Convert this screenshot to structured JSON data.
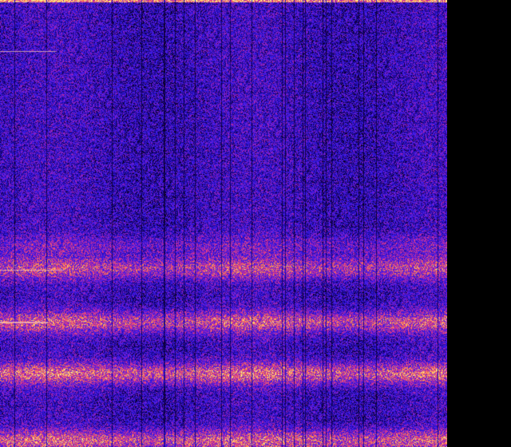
{
  "image": {
    "kind": "spectrogram",
    "description_hidden": "",
    "palette": [
      "#000000",
      "#1a0080",
      "#2a10d0",
      "#4020f0",
      "#9020c0",
      "#e04080",
      "#ff8040",
      "#fff080"
    ],
    "background": "#000000",
    "bands": [
      {
        "level": 0.55,
        "strength": 0.35
      },
      {
        "level": 0.6,
        "strength": 0.75
      },
      {
        "level": 0.72,
        "strength": 0.85
      },
      {
        "level": 0.835,
        "strength": 0.95
      },
      {
        "level": 0.985,
        "strength": 0.9
      }
    ]
  }
}
